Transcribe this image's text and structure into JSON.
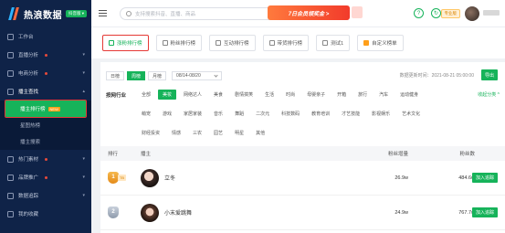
{
  "brand": {
    "name": "热浪数据",
    "badge": "抖音版 ▾"
  },
  "sidebar": {
    "items": [
      {
        "label": "工作台"
      },
      {
        "label": "直播分析",
        "chev": "▾",
        "dot": true
      },
      {
        "label": "电商分析",
        "chev": "▾",
        "dot": true
      },
      {
        "label": "播主查找",
        "chev": "▴"
      },
      {
        "label": "热门素材",
        "chev": "▾",
        "dot": true
      },
      {
        "label": "品牌推广",
        "chev": "▾",
        "dot": true
      },
      {
        "label": "数据追踪",
        "chev": "▾"
      },
      {
        "label": "我的收藏"
      }
    ],
    "submenu": [
      {
        "label": "播主排行榜",
        "badge": "NEW",
        "active": true
      },
      {
        "label": "星图热榜"
      },
      {
        "label": "播主搜索"
      }
    ]
  },
  "topbar": {
    "search_placeholder": "支持搜索抖音、直播、商品",
    "promo": "7日会员领奖金 >",
    "help": "?",
    "refresh": "↻",
    "plan": "专业版"
  },
  "tabs": [
    {
      "label": "涨粉排行榜",
      "active": true
    },
    {
      "label": "粉丝排行榜"
    },
    {
      "label": "互动排行榜"
    },
    {
      "label": "带货排行榜"
    },
    {
      "label": "测试1"
    },
    {
      "label": "自定义榜单",
      "custom": true
    }
  ],
  "datebar": {
    "periods": [
      "日榜",
      "周榜",
      "月榜"
    ],
    "active_period": "周榜",
    "date": "08/14-08/20",
    "update_time": "数据更新时间：2021-08-21 05:00:00",
    "export": "导出"
  },
  "filter": {
    "label": "按网行业",
    "tags": [
      "全部",
      "美妆",
      "网络达人",
      "美食",
      "剧情搞笑",
      "生活",
      "时尚",
      "母婴亲子",
      "开箱",
      "旅行",
      "汽车",
      "运动健身",
      "萌宠",
      "游戏",
      "家居家装",
      "音乐",
      "舞蹈",
      "二次元",
      "科技数码",
      "教育培训",
      "才艺技能",
      "影视娱乐",
      "艺术文化",
      "财经投资",
      "情感",
      "三农",
      "园艺",
      "明星",
      "其他"
    ],
    "active": "美妆",
    "collapse": "收起分类 ^"
  },
  "table": {
    "headers": {
      "rank": "排行",
      "blogger": "播主",
      "gain": "粉丝增量",
      "fans": "粉丝数"
    },
    "rows": [
      {
        "rank": "1",
        "tag": "TB",
        "name": "立冬",
        "gain": "26.9w",
        "fans": "484.6w",
        "action": "加入追踪"
      },
      {
        "rank": "2",
        "tag": "",
        "name": "小末爱跳舞",
        "gain": "24.9w",
        "fans": "767.7w",
        "action": "加入追踪"
      }
    ]
  }
}
